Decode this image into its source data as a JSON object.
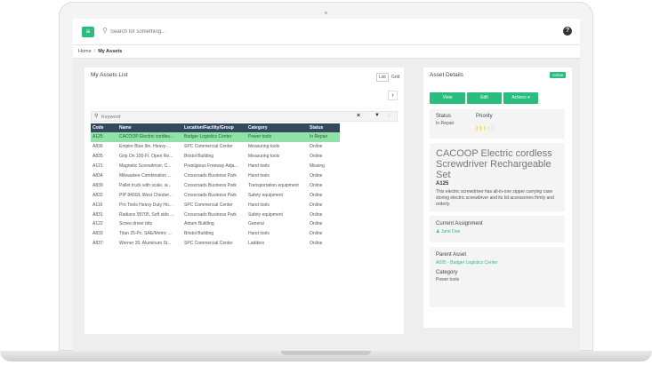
{
  "header": {
    "menu_icon": "menu-icon",
    "search_placeholder": "Search for something...",
    "help_icon": "?"
  },
  "breadcrumb": {
    "home": "Home",
    "sep": "/",
    "current": "My Assets"
  },
  "assets_list": {
    "title": "My Assets List",
    "view_list": "List",
    "view_grid": "Grid",
    "next_arrow": "›",
    "keyword_placeholder": "Keyword",
    "clear": "×",
    "filter": "▼",
    "columns": [
      "Code",
      "Name",
      "Location/Facility/Group",
      "Category",
      "Status"
    ],
    "rows": [
      [
        "A125",
        "CACOOP Electric cordles...",
        "Badger Logistics Center",
        "Power tools",
        "In Repair"
      ],
      [
        "A836",
        "Empire Blue 9in. Heavy-...",
        "SPC Commercial Center",
        "Measuring tools",
        "Online"
      ],
      [
        "A835",
        "Grip On 100-Ft. Open Re...",
        "Bristol Building",
        "Measuring tools",
        "Online"
      ],
      [
        "A121",
        "Magnetic Screwdriver, C...",
        "Prestigious Freeway Adja...",
        "Hand tools",
        "Missing"
      ],
      [
        "A834",
        "Milwaukee Combination ...",
        "Crossroads Business Park",
        "Hand tools",
        "Online"
      ],
      [
        "A839",
        "Pallet truck with scale, w...",
        "Crossroads Business Park",
        "Transportation equipment",
        "Online"
      ],
      [
        "A832",
        "PIP 8400/L West Chester...",
        "Crossroads Business Park",
        "Safety equipment",
        "Online"
      ],
      [
        "A116",
        "Pro Tools Heavy Duty Ho...",
        "SPC Commercial Center",
        "Hand tools",
        "Online"
      ],
      [
        "A831",
        "Radians 99705, Soft side ...",
        "Crossroads Business Park",
        "Safety equipment",
        "Online"
      ],
      [
        "A122",
        "Screw driver bits",
        "Atrium Building",
        "General",
        "Online"
      ],
      [
        "A833",
        "Titan 25-Pc. SAE/Metric ...",
        "Bristol Building",
        "Hand tools",
        "Online"
      ],
      [
        "A837",
        "Werner 20. Aluminum St...",
        "SPC Commercial Center",
        "Ladders",
        "Online"
      ]
    ]
  },
  "details": {
    "title": "Asset Details",
    "badge": "Active",
    "btn_view": "View",
    "btn_edit": "Edit",
    "btn_actions": "Actions ▾",
    "status_label": "Status",
    "status_value": "In Repair",
    "priority_label": "Priority",
    "priority_value": 3,
    "priority_max": 5,
    "asset_title": "CACOOP Electric cordless Screwdriver Rechargeable Set",
    "asset_code": "A125",
    "asset_desc": "This electric screwdriver has all-in-one zipper carrying case storing electric screwdriver and its bit accessories firmly and orderly.",
    "assignment_label": "Current Assignment",
    "assignee": "Jane Doe",
    "parent_label": "Parent Asset",
    "parent_value": "A095 - Badger Logistics Center",
    "category_label": "Category",
    "category_value": "Power tools"
  },
  "colors": {
    "accent": "#2bbd7e",
    "header_dark": "#34495e",
    "selected_row": "#8fe1a6"
  }
}
